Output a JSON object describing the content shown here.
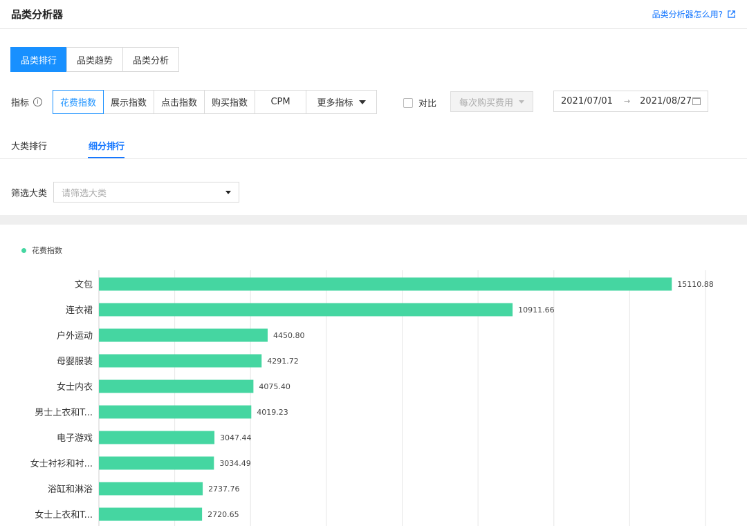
{
  "header": {
    "title": "品类分析器",
    "help_link": "品类分析器怎么用?"
  },
  "top_tabs": [
    "品类排行",
    "品类趋势",
    "品类分析"
  ],
  "metric": {
    "label": "指标",
    "options": [
      "花费指数",
      "展示指数",
      "点击指数",
      "购买指数",
      "CPM",
      "更多指标"
    ],
    "compare_label": "对比",
    "compare_select": "每次购买费用",
    "date_start": "2021/07/01",
    "date_end": "2021/08/27"
  },
  "sub_tabs": [
    "大类排行",
    "细分排行"
  ],
  "filter": {
    "label": "筛选大类",
    "placeholder": "请筛选大类"
  },
  "colors": {
    "accent": "#1890ff",
    "bar": "#45d6a1"
  },
  "chart_data": {
    "type": "bar",
    "orientation": "horizontal",
    "legend": "花费指数",
    "categories": [
      "文包",
      "连衣裙",
      "户外运动",
      "母婴服装",
      "女士内衣",
      "男士上衣和T...",
      "电子游戏",
      "女士衬衫和衬...",
      "浴缸和淋浴",
      "女士上衣和T..."
    ],
    "values": [
      15110.88,
      10911.66,
      4450.8,
      4291.72,
      4075.4,
      4019.23,
      3047.44,
      3034.49,
      2737.76,
      2720.65
    ],
    "labels": [
      "15110.88",
      "10911.66",
      "4450.80",
      "4291.72",
      "4075.40",
      "4019.23",
      "3047.44",
      "3034.49",
      "2737.76",
      "2720.65"
    ],
    "xlim": [
      0,
      16000
    ],
    "grid": true
  }
}
